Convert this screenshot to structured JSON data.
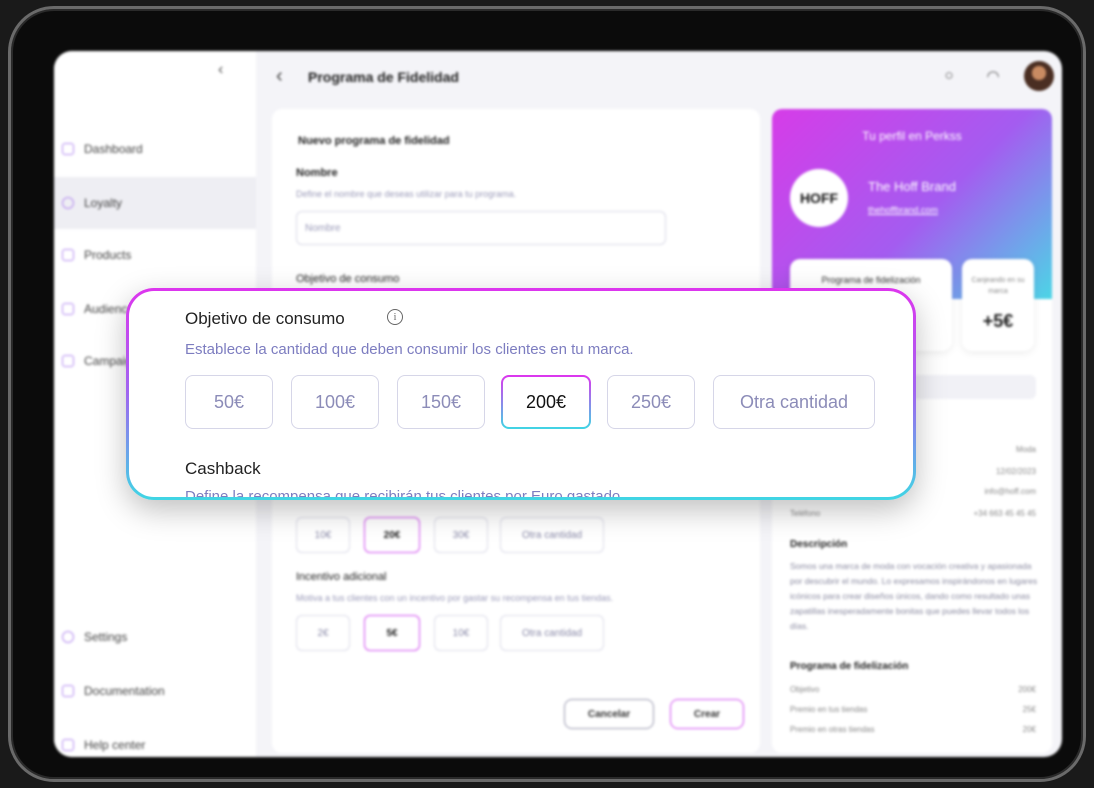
{
  "sidebar": {
    "items": [
      {
        "label": "Dashboard"
      },
      {
        "label": "Loyalty"
      },
      {
        "label": "Products"
      },
      {
        "label": "Audiences"
      },
      {
        "label": "Campaigns"
      },
      {
        "label": "Settings"
      },
      {
        "label": "Documentation"
      },
      {
        "label": "Help center"
      }
    ]
  },
  "header": {
    "title": "Programa de Fidelidad"
  },
  "form": {
    "card_title": "Nuevo programa de fidelidad",
    "name_label": "Nombre",
    "name_help": "Define el nombre que deseas utilizar para tu programa.",
    "name_placeholder": "Nombre",
    "goal_label": "Objetivo de consumo",
    "cashback_options": [
      "10€",
      "20€",
      "30€",
      "Otra cantidad"
    ],
    "incentive_label": "Incentivo adicional",
    "incentive_help": "Motiva a tus clientes con un incentivo por gastar su recompensa en tus tiendas.",
    "incentive_options": [
      "2€",
      "5€",
      "10€",
      "Otra cantidad"
    ],
    "cancel_label": "Cancelar",
    "create_label": "Crear"
  },
  "zoom": {
    "goal_title": "Objetivo de consumo",
    "goal_help": "Establece la cantidad que deben consumir los clientes en tu marca.",
    "goal_options": [
      "50€",
      "100€",
      "150€",
      "200€",
      "250€",
      "Otra cantidad"
    ],
    "selected_goal": "200€",
    "cashback_title": "Cashback",
    "cashback_help": "Define la recompensa que recibirán tus clientes por Euro gastado."
  },
  "profile": {
    "title": "Tu perfil en Perkss",
    "logo_text": "HOFF",
    "brand_name": "The Hoff Brand",
    "brand_url": "thehoffbrand.com",
    "stat_program": "Programa de fidelización",
    "stat_redeem": "Canjeando en su marca",
    "stat_redeem_value": "+5€",
    "info_rows": [
      {
        "key": "",
        "value": "Moda"
      },
      {
        "key": "",
        "value": "12/02/2023"
      },
      {
        "key": "",
        "value": "info@hoff.com"
      },
      {
        "key": "Teléfono",
        "value": "+34 663 45 45 45"
      }
    ],
    "description_title": "Descripción",
    "description": "Somos una marca de moda con vocación creativa y apasionada por descubrir el mundo. Lo expresamos inspirándonos en lugares icónicos para crear diseños únicos, dando como resultado unas zapatillas inesperadamente bonitas que puedes llevar todos los días.",
    "program_title": "Programa de fidelización",
    "program_rows": [
      {
        "key": "Objetivo",
        "value": "200€"
      },
      {
        "key": "Premio en tus tiendas",
        "value": "25€"
      },
      {
        "key": "Premio en otras tiendas",
        "value": "20€"
      }
    ]
  },
  "colors": {
    "accent_magenta": "#dd35ee",
    "accent_cyan": "#3fd6e4"
  }
}
